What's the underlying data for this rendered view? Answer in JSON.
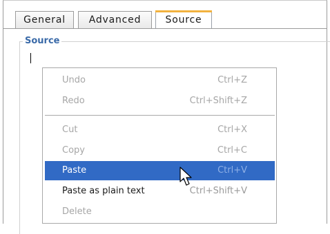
{
  "tabs": [
    {
      "label": "General"
    },
    {
      "label": "Advanced"
    },
    {
      "label": "Source"
    }
  ],
  "fieldset": {
    "legend": "Source"
  },
  "context_menu": {
    "items": [
      {
        "label": "Undo",
        "shortcut": "Ctrl+Z",
        "enabled": false
      },
      {
        "label": "Redo",
        "shortcut": "Ctrl+Shift+Z",
        "enabled": false
      },
      {
        "label": "Cut",
        "shortcut": "Ctrl+X",
        "enabled": false
      },
      {
        "label": "Copy",
        "shortcut": "Ctrl+C",
        "enabled": false
      },
      {
        "label": "Paste",
        "shortcut": "Ctrl+V",
        "enabled": true,
        "highlighted": true
      },
      {
        "label": "Paste as plain text",
        "shortcut": "Ctrl+Shift+V",
        "enabled": true
      },
      {
        "label": "Delete",
        "shortcut": "",
        "enabled": false
      }
    ]
  },
  "colors": {
    "accent_tab": "#f2b23e",
    "highlight": "#316ac5",
    "legend": "#3a6aa8"
  },
  "icons": {
    "pointer": "mouse-pointer-icon"
  }
}
